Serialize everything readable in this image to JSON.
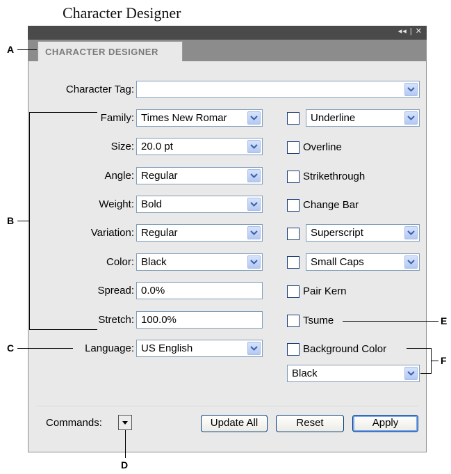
{
  "page_title": "Character Designer",
  "panel": {
    "tab_label": "CHARACTER DESIGNER",
    "titlebar_controls": "◂◂ | ✕"
  },
  "fields": {
    "character_tag": {
      "label": "Character Tag:",
      "value": ""
    },
    "family": {
      "label": "Family:",
      "value": "Times New Romar"
    },
    "size": {
      "label": "Size:",
      "value": "20.0 pt"
    },
    "angle": {
      "label": "Angle:",
      "value": "Regular"
    },
    "weight": {
      "label": "Weight:",
      "value": "Bold"
    },
    "variation": {
      "label": "Variation:",
      "value": "Regular"
    },
    "color": {
      "label": "Color:",
      "value": "Black"
    },
    "spread": {
      "label": "Spread:",
      "value": "0.0%"
    },
    "stretch": {
      "label": "Stretch:",
      "value": "100.0%"
    },
    "language": {
      "label": "Language:",
      "value": "US English"
    }
  },
  "options": {
    "underline": "Underline",
    "overline": "Overline",
    "strikethrough": "Strikethrough",
    "change_bar": "Change Bar",
    "superscript": "Superscript",
    "small_caps": "Small Caps",
    "pair_kern": "Pair Kern",
    "tsume": "Tsume",
    "background_color": "Background Color",
    "background_color_value": "Black"
  },
  "footer": {
    "commands_label": "Commands:",
    "update_all": "Update All",
    "reset": "Reset",
    "apply": "Apply"
  },
  "callouts": {
    "a": "A",
    "b": "B",
    "c": "C",
    "d": "D",
    "e": "E",
    "f": "F"
  },
  "colors": {
    "titlebar": "#4a4a4a",
    "panel_bg": "#e9e9e9",
    "tabstrip": "#8c8c8c",
    "field_border": "#7f9db9",
    "dropdown_button": "#c4d6f7",
    "checkbox_border": "#1c3f7b"
  },
  "icons": [
    "chevron-down-icon",
    "collapse-icon",
    "close-icon"
  ]
}
